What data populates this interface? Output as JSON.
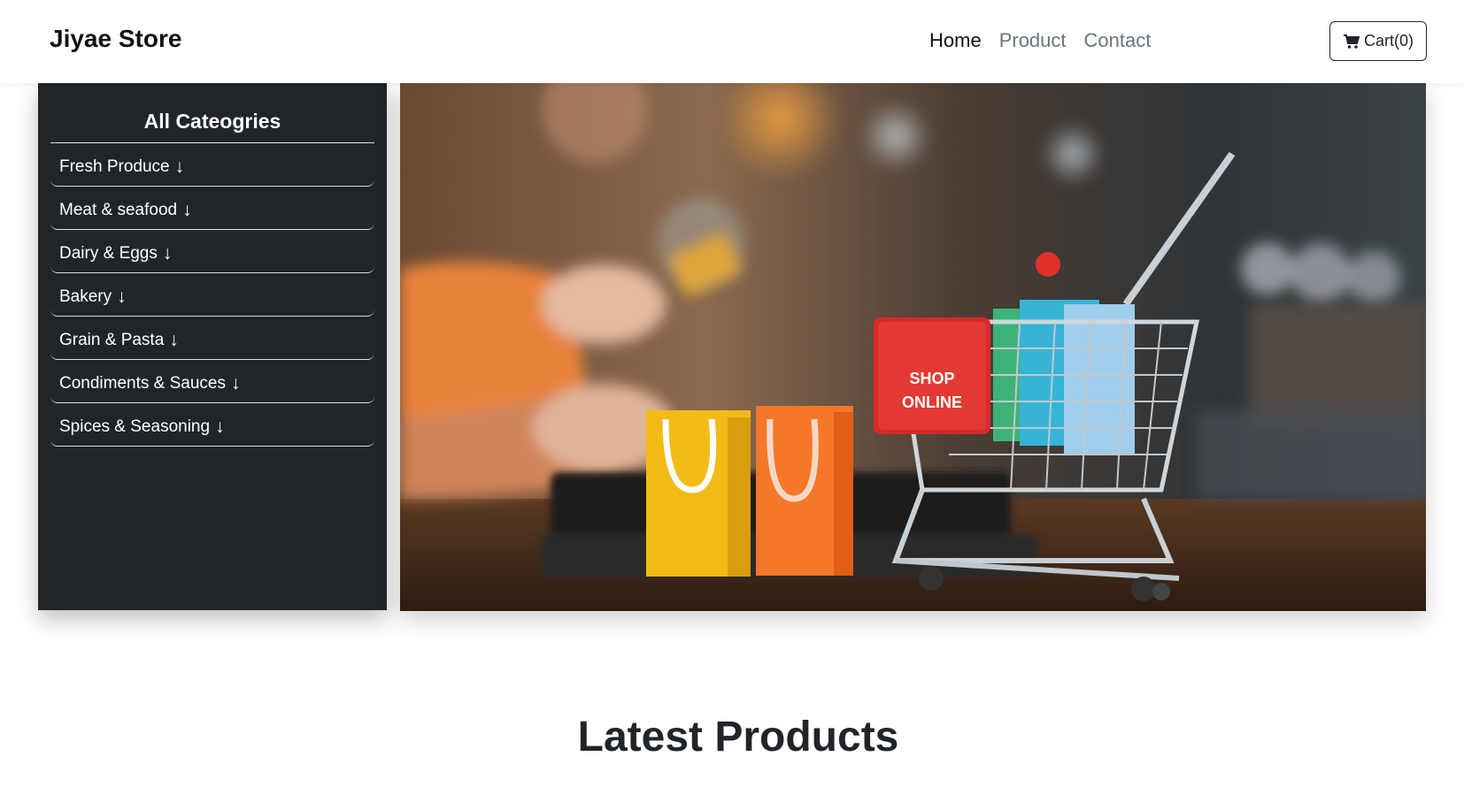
{
  "navbar": {
    "brand": "Jiyae Store",
    "links": [
      {
        "label": "Home",
        "active": true
      },
      {
        "label": "Product",
        "active": false
      },
      {
        "label": "Contact",
        "active": false
      }
    ],
    "cart_label": "Cart(0)",
    "cart_icon": "shopping-cart-icon"
  },
  "sidebar": {
    "title": "All Cateogries",
    "items": [
      {
        "label": "Fresh Produce",
        "icon": "arrow-down-icon"
      },
      {
        "label": "Meat & seafood",
        "icon": "arrow-down-icon"
      },
      {
        "label": "Dairy & Eggs",
        "icon": "arrow-down-icon"
      },
      {
        "label": "Bakery",
        "icon": "arrow-down-icon"
      },
      {
        "label": "Grain & Pasta",
        "icon": "arrow-down-icon"
      },
      {
        "label": "Condiments & Sauces",
        "icon": "arrow-down-icon"
      },
      {
        "label": "Spices & Seasoning",
        "icon": "arrow-down-icon"
      }
    ]
  },
  "hero": {
    "sign_text_line1": "SHOP",
    "sign_text_line2": "ONLINE"
  },
  "main": {
    "section_title": "Latest Products"
  },
  "colors": {
    "sidebar_bg": "#212529",
    "text_dark": "#212529",
    "nav_muted": "#6c757d"
  }
}
